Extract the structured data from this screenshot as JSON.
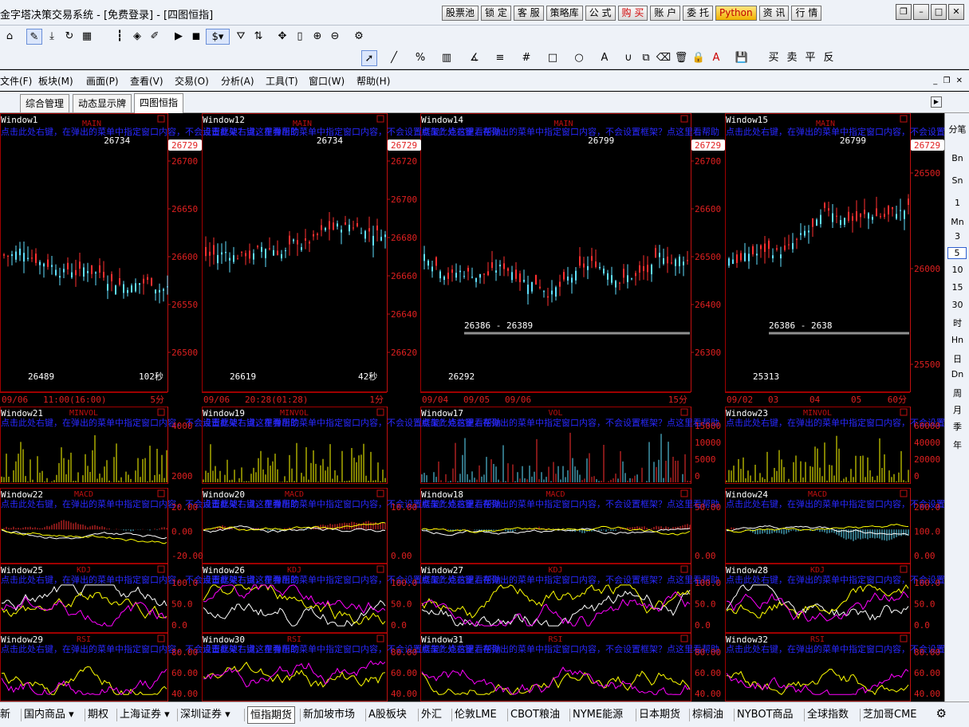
{
  "title": "金字塔决策交易系统 - [免费登录] - [四图恒指]",
  "top_buttons": [
    "股票池",
    "锁 定",
    "客 服",
    "策略库",
    "公 式",
    "购 买",
    "账 户",
    "委 托",
    "Python",
    "资 讯",
    "行 情"
  ],
  "window_controls": [
    "❐",
    "–",
    "□",
    "✕"
  ],
  "menus": [
    "文件(F)",
    "板块(M)",
    "画面(P)",
    "查看(V)",
    "交易(O)",
    "分析(A)",
    "工具(T)",
    "窗口(W)",
    "帮助(H)"
  ],
  "tabs": [
    "综合管理",
    "动态显示牌",
    "四图恒指"
  ],
  "active_tab": 2,
  "toolbar_trade": [
    "买",
    "卖",
    "平",
    "反"
  ],
  "sidebar": [
    "分笔",
    "Bn",
    "Sn",
    "1",
    "Mn",
    "3",
    "5",
    "10",
    "15",
    "30",
    "时",
    "Hn",
    "日",
    "Dn",
    "周",
    "月",
    "季",
    "年"
  ],
  "sidebar_selected": 6,
  "bottom_tabs": [
    "新",
    "国内商品 ▾",
    "期权",
    "上海证券 ▾",
    "深圳证券 ▾",
    "恒指期货",
    "新加坡市场",
    "A股板块",
    "外汇",
    "伦敦LME",
    "CBOT粮油",
    "NYME能源",
    "日本期货",
    "棕榈油",
    "NYBOT商品",
    "全球指数",
    "芝加哥CME"
  ],
  "bottom_active": 5,
  "colors": {
    "grid": "#a00000",
    "axis": "#c01010",
    "label": "#e02020",
    "up": "#ff3030",
    "down": "#60e0ff",
    "text": "#ffffff",
    "hint": "#2828ff",
    "yellow": "#ffff00",
    "magenta": "#ff00ff",
    "green": "#20d020",
    "gray": "#909090"
  },
  "hint_text": "点击此处右键，在弹出的菜单中指定窗口内容，不会设置框架？点这里看帮助",
  "main_panels": [
    {
      "win": "Window1",
      "name": "MAIN",
      "hi": "26734",
      "lo": "26489",
      "last": "26729",
      "period": "5分",
      "axis": [
        "26700",
        "26650",
        "26600",
        "26550",
        "26500"
      ],
      "dates": [
        "09/06",
        "11:00(16:00)"
      ],
      "note": "102秒"
    },
    {
      "win": "Window12",
      "name": "MAIN",
      "hi": "26734",
      "lo": "26619",
      "last": "26729",
      "period": "1分",
      "axis": [
        "26720",
        "26700",
        "26680",
        "26660",
        "26640",
        "26620"
      ],
      "dates": [
        "09/06",
        "20:28(01:28)"
      ],
      "note": "42秒"
    },
    {
      "win": "Window14",
      "name": "MAIN",
      "hi": "26799",
      "lo": "26292",
      "last": "26729",
      "period": "15分",
      "axis": [
        "26700",
        "26600",
        "26500",
        "26400",
        "26300"
      ],
      "dates": [
        "09/04",
        "09/05",
        "09/06"
      ],
      "note": "",
      "box": "26386 - 26389"
    },
    {
      "win": "Window15",
      "name": "MAIN",
      "hi": "26799",
      "lo": "25313",
      "last": "26729",
      "period": "60分",
      "axis": [
        "26500",
        "26000",
        "25500"
      ],
      "dates": [
        "09/02",
        "03",
        "04",
        "05"
      ],
      "note": "",
      "box": "26386 - 2638"
    }
  ],
  "sub_rows": [
    {
      "panels": [
        {
          "win": "Window21",
          "name": "MINVOL",
          "axis": [
            "4000",
            "2000"
          ]
        },
        {
          "win": "Window19",
          "name": "MINVOL",
          "axis": []
        },
        {
          "win": "Window17",
          "name": "VOL",
          "axis": [
            "15000",
            "10000",
            "5000",
            "0"
          ]
        },
        {
          "win": "Window23",
          "name": "MINVOL",
          "axis": [
            "60000",
            "40000",
            "20000",
            "0"
          ]
        }
      ]
    },
    {
      "panels": [
        {
          "win": "Window22",
          "name": "MACD",
          "axis": [
            "20.00",
            "0.00",
            "-20.00"
          ]
        },
        {
          "win": "Window20",
          "name": "MACD",
          "axis": [
            "10.00",
            "0.00"
          ]
        },
        {
          "win": "Window18",
          "name": "MACD",
          "axis": [
            "50.00",
            "0.00"
          ]
        },
        {
          "win": "Window24",
          "name": "MACD",
          "axis": [
            "200.0",
            "100.0",
            "0.00"
          ]
        }
      ]
    },
    {
      "panels": [
        {
          "win": "Window25",
          "name": "KDJ",
          "axis": [
            "100.0",
            "50.0",
            "0.0"
          ]
        },
        {
          "win": "Window26",
          "name": "KDJ",
          "axis": [
            "100.0",
            "50.0",
            "0.0"
          ]
        },
        {
          "win": "Window27",
          "name": "KDJ",
          "axis": [
            "100.0",
            "50.0",
            "0.0"
          ]
        },
        {
          "win": "Window28",
          "name": "KDJ",
          "axis": [
            "100.0",
            "50.0",
            "0.0"
          ]
        }
      ]
    },
    {
      "panels": [
        {
          "win": "Window29",
          "name": "RSI",
          "axis": [
            "80.00",
            "60.00",
            "40.00"
          ]
        },
        {
          "win": "Window30",
          "name": "RSI",
          "axis": [
            "80.00",
            "60.00",
            "40.00"
          ]
        },
        {
          "win": "Window31",
          "name": "RSI",
          "axis": [
            "80.00",
            "60.00",
            "40.00"
          ]
        },
        {
          "win": "Window32",
          "name": "RSI",
          "axis": [
            "80.00",
            "60.00",
            "40.00"
          ]
        }
      ]
    }
  ]
}
